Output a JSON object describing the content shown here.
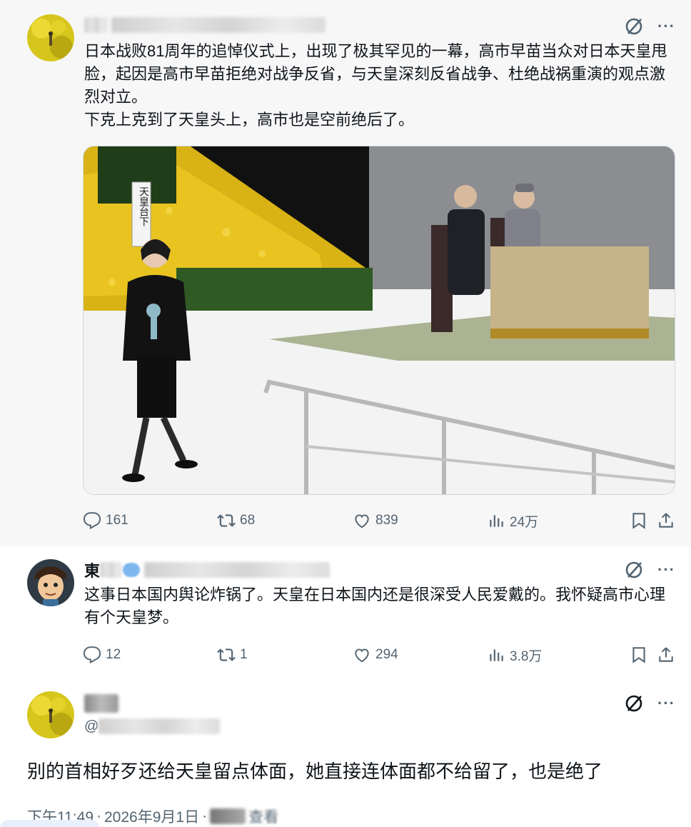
{
  "thread": [
    {
      "id": "tweet-1",
      "name_visible": "",
      "handle_visible": "@",
      "text": "日本战败81周年的追悼仪式上，出现了极其罕见的一幕，高市早苗当众对日本天皇甩脸，起因是高市早苗拒绝对战争反省，与天皇深刻反省战争、杜绝战祸重演的观点激烈对立。\n下克上克到了天皇头上，高市也是空前绝后了。",
      "stats": {
        "replies": "161",
        "retweets": "68",
        "likes": "839",
        "views": "24万"
      },
      "sign_text": "天皇台下",
      "colors": {
        "chrysanthemum": "#e9c320",
        "background_stage": "#111111"
      }
    },
    {
      "id": "tweet-2",
      "name_visible": "東",
      "text": "这事日本国内舆论炸锅了。天皇在日本国内还是很深受人民爱戴的。我怀疑高市心理有个天皇梦。",
      "stats": {
        "replies": "12",
        "retweets": "1",
        "likes": "294",
        "views": "3.8万"
      }
    }
  ],
  "main_tweet": {
    "handle_visible": "@",
    "text": "别的首相好歹还给天皇留点体面，她直接连体面都不给留了，也是绝了",
    "time": "下午11:49",
    "date": "2026年9月1日",
    "separator": "·",
    "views_suffix": "查看"
  },
  "icons": {
    "reply": "reply-icon",
    "retweet": "retweet-icon",
    "like": "heart-icon",
    "views": "views-icon",
    "bookmark": "bookmark-icon",
    "share": "share-icon",
    "grok": "grok-icon",
    "more": "more-icon"
  },
  "colors": {
    "meta_gray": "#536471",
    "thread_line": "#cfd9de",
    "text": "#0f1419"
  }
}
